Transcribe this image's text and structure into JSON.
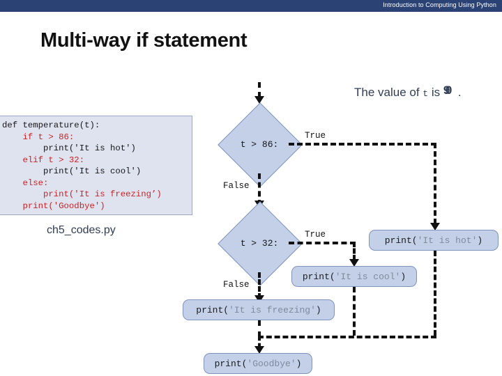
{
  "header": {
    "title": "Introduction to Computing Using Python",
    "bar_color": "#2b4274"
  },
  "slide": {
    "title": "Multi-way if statement"
  },
  "caption": {
    "prefix": "The value of ",
    "variable": "t",
    "middle": " is ",
    "value_a": "9",
    "value_b": "0",
    "suffix": "."
  },
  "code_panel": {
    "filename": "ch5_codes.py",
    "background": "#dfe3ef",
    "border": "#9aa6c4",
    "lines": [
      {
        "text": "def temperature(t):",
        "color": "black"
      },
      {
        "text": "    if t > 86:",
        "color": "red"
      },
      {
        "text": "        print('It is hot')",
        "color": "black"
      },
      {
        "text": "    elif t > 32:",
        "color": "red"
      },
      {
        "text": "        print('It is cool')",
        "color": "black"
      },
      {
        "text": "    else:",
        "color": "red"
      },
      {
        "text": "        print('It is freezing’)",
        "color": "red"
      },
      {
        "text": "    print('Goodbye')",
        "color": "red"
      }
    ]
  },
  "flowchart": {
    "shape_fill": "#c3d0e8",
    "shape_border": "#7d93bd",
    "line_color": "#111111",
    "decisions": [
      {
        "id": "decision-t-gt-86",
        "label": "t > 86:",
        "true_label": "True",
        "false_label": "False"
      },
      {
        "id": "decision-t-gt-32",
        "label": "t > 32:",
        "true_label": "True",
        "false_label": "False"
      }
    ],
    "statements": [
      {
        "id": "stmt-print-hot",
        "call": "print(",
        "string": "'It is hot'",
        "close": ")"
      },
      {
        "id": "stmt-print-cool",
        "call": "print(",
        "string": "'It is cool'",
        "close": ")"
      },
      {
        "id": "stmt-print-freezing",
        "call": "print(",
        "string": "'It is freezing'",
        "close": ")"
      },
      {
        "id": "stmt-print-goodbye",
        "call": "print(",
        "string": "'Goodbye'",
        "close": ")"
      }
    ]
  }
}
